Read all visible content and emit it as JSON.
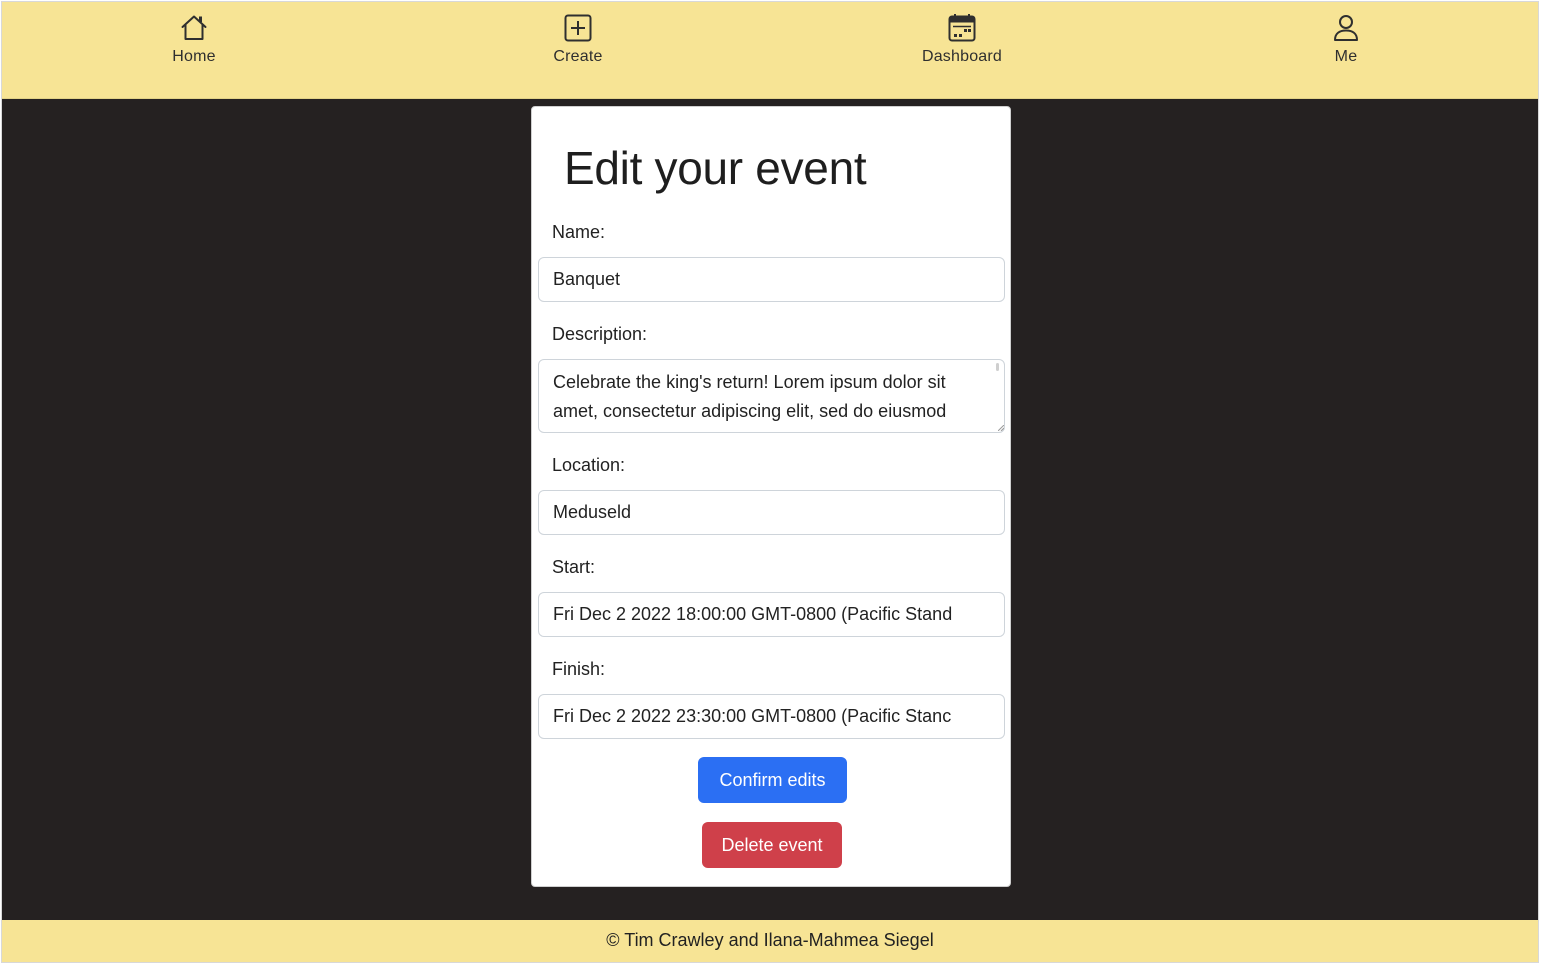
{
  "nav": {
    "items": [
      {
        "label": "Home",
        "icon": "house-icon"
      },
      {
        "label": "Create",
        "icon": "plus-square-icon"
      },
      {
        "label": "Dashboard",
        "icon": "calendar-icon"
      },
      {
        "label": "Me",
        "icon": "person-icon"
      }
    ]
  },
  "form": {
    "title": "Edit your event",
    "name_label": "Name:",
    "name_value": "Banquet",
    "description_label": "Description:",
    "description_value": "Celebrate the king's return! Lorem ipsum dolor sit amet, consectetur adipiscing elit, sed do eiusmod",
    "location_label": "Location:",
    "location_value": "Meduseld",
    "start_label": "Start:",
    "start_value": "Fri Dec 2 2022 18:00:00 GMT-0800 (Pacific Stand",
    "finish_label": "Finish:",
    "finish_value": "Fri Dec 2 2022 23:30:00 GMT-0800 (Pacific Stanc",
    "confirm_label": "Confirm edits",
    "delete_label": "Delete event"
  },
  "footer": {
    "text": "© Tim Crawley and Ilana-Mahmea Siegel"
  },
  "colors": {
    "nav_background": "#f7e495",
    "page_background": "#252121",
    "confirm_button": "#2b6ff3",
    "delete_button": "#cf404a"
  }
}
